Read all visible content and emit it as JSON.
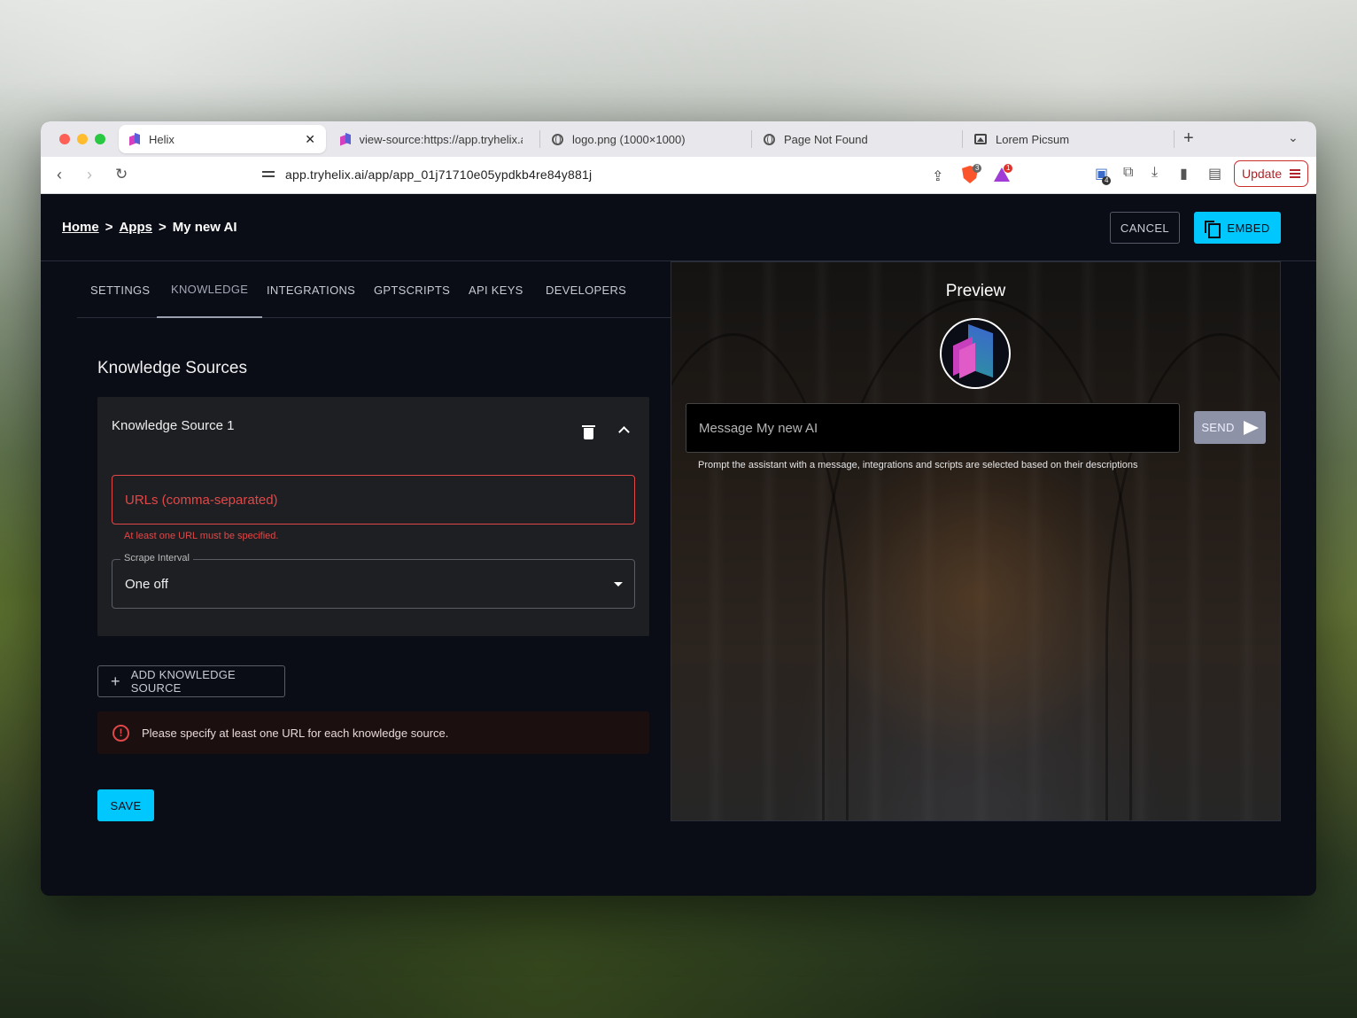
{
  "browser": {
    "tabs": [
      {
        "title": "Helix",
        "active": true,
        "icon": "helix-favicon"
      },
      {
        "title": "view-source:https://app.tryhelix.ai",
        "active": false,
        "icon": "helix-favicon"
      },
      {
        "title": "logo.png (1000×1000)",
        "active": false,
        "icon": "globe-icon"
      },
      {
        "title": "Page Not Found",
        "active": false,
        "icon": "globe-icon"
      },
      {
        "title": "Lorem Picsum",
        "active": false,
        "icon": "image-icon"
      }
    ],
    "tab_close": "✕",
    "url": "app.tryhelix.ai/app/app_01j71710e05ypdkb4re84y881j",
    "brave_shield_badge": "3",
    "rewards_badge": "1",
    "extensions_badge": "4",
    "update_label": "Update"
  },
  "app": {
    "breadcrumb": {
      "home": "Home",
      "sep1": ">",
      "apps": "Apps",
      "sep2": ">",
      "current": "My new AI"
    },
    "cancel_label": "CANCEL",
    "embed_label": "EMBED",
    "tabs": [
      {
        "label": "SETTINGS",
        "active": false
      },
      {
        "label": "KNOWLEDGE",
        "active": true
      },
      {
        "label": "INTEGRATIONS",
        "active": false
      },
      {
        "label": "GPTSCRIPTS",
        "active": false
      },
      {
        "label": "API KEYS",
        "active": false
      },
      {
        "label": "DEVELOPERS",
        "active": false
      }
    ],
    "knowledge": {
      "section_title": "Knowledge Sources",
      "source_title": "Knowledge Source 1",
      "url_placeholder": "URLs (comma-separated)",
      "url_error": "At least one URL must be specified.",
      "scrape_label": "Scrape Interval",
      "scrape_value": "One off",
      "add_label": "ADD KNOWLEDGE SOURCE",
      "alert_text": "Please specify at least one URL for each knowledge source.",
      "save_label": "SAVE"
    },
    "preview": {
      "title": "Preview",
      "message_placeholder": "Message My new AI",
      "send_label": "SEND",
      "helper": "Prompt the assistant with a message, integrations and scripts are selected based on their descriptions"
    }
  },
  "colors": {
    "accent": "#00c8ff",
    "error": "#e04848",
    "background": "#0a0c16"
  }
}
